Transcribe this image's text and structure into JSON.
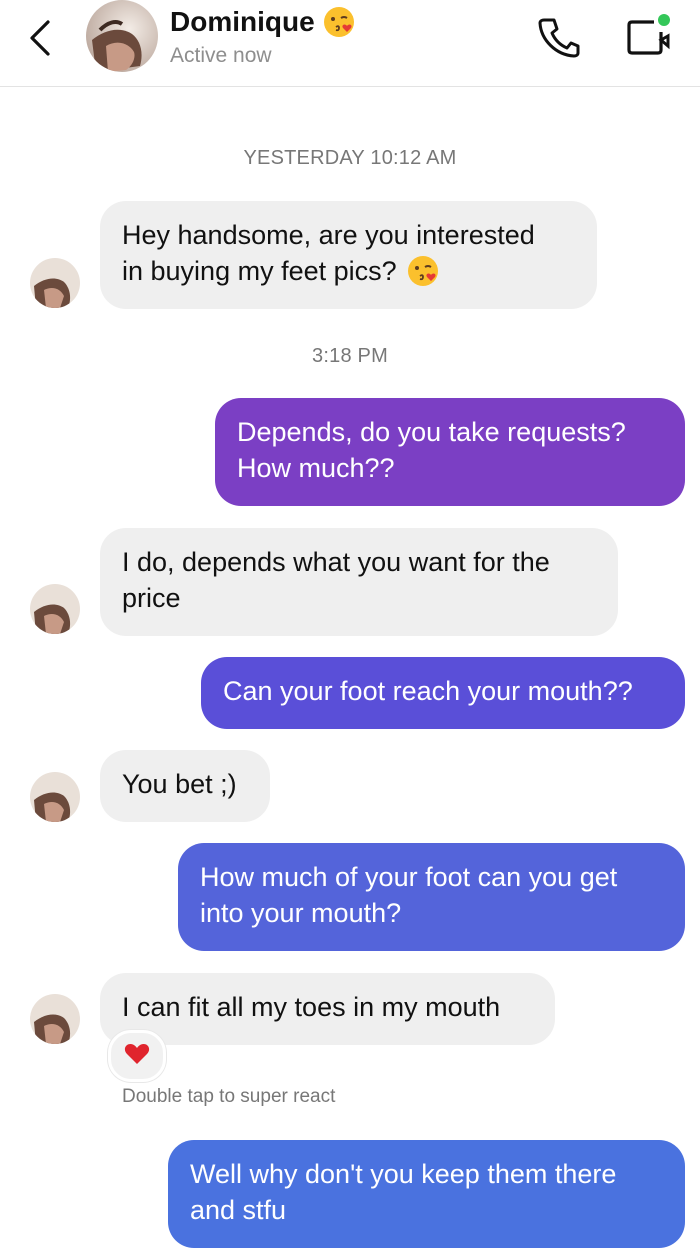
{
  "header": {
    "contact_name": "Dominique",
    "status": "Active now",
    "name_emoji": "face-blowing-kiss-icon"
  },
  "timestamps": {
    "first": "YESTERDAY 10:12 AM",
    "second": "3:18 PM"
  },
  "messages": [
    {
      "from": "them",
      "line1": "Hey handsome, are you interested",
      "line2": "in buying my feet pics?",
      "emoji": "face-blowing-kiss-icon"
    },
    {
      "from": "me",
      "line1": "Depends, do you take requests?",
      "line2": "How much??"
    },
    {
      "from": "them",
      "line1": "I do, depends what you want for the",
      "line2": "price"
    },
    {
      "from": "me",
      "line1": "Can your foot reach your mouth??"
    },
    {
      "from": "them",
      "line1": "You bet ;)"
    },
    {
      "from": "me",
      "line1": "How much of your foot can you get",
      "line2": "into your mouth?"
    },
    {
      "from": "them",
      "line1": "I can fit all my toes in my mouth",
      "reaction": "heart-icon"
    },
    {
      "from": "me",
      "line1": "Well why don't you keep them there",
      "line2": "and stfu"
    }
  ],
  "reaction_hint": "Double tap to super react",
  "colors": {
    "incoming_bubble": "#efefef",
    "outgoing_purple": "#7b3fc4",
    "outgoing_indigo": "#5a4fd8",
    "outgoing_blue": "#4a72df",
    "reaction_heart": "#e0242d",
    "online_dot": "#34c759"
  }
}
